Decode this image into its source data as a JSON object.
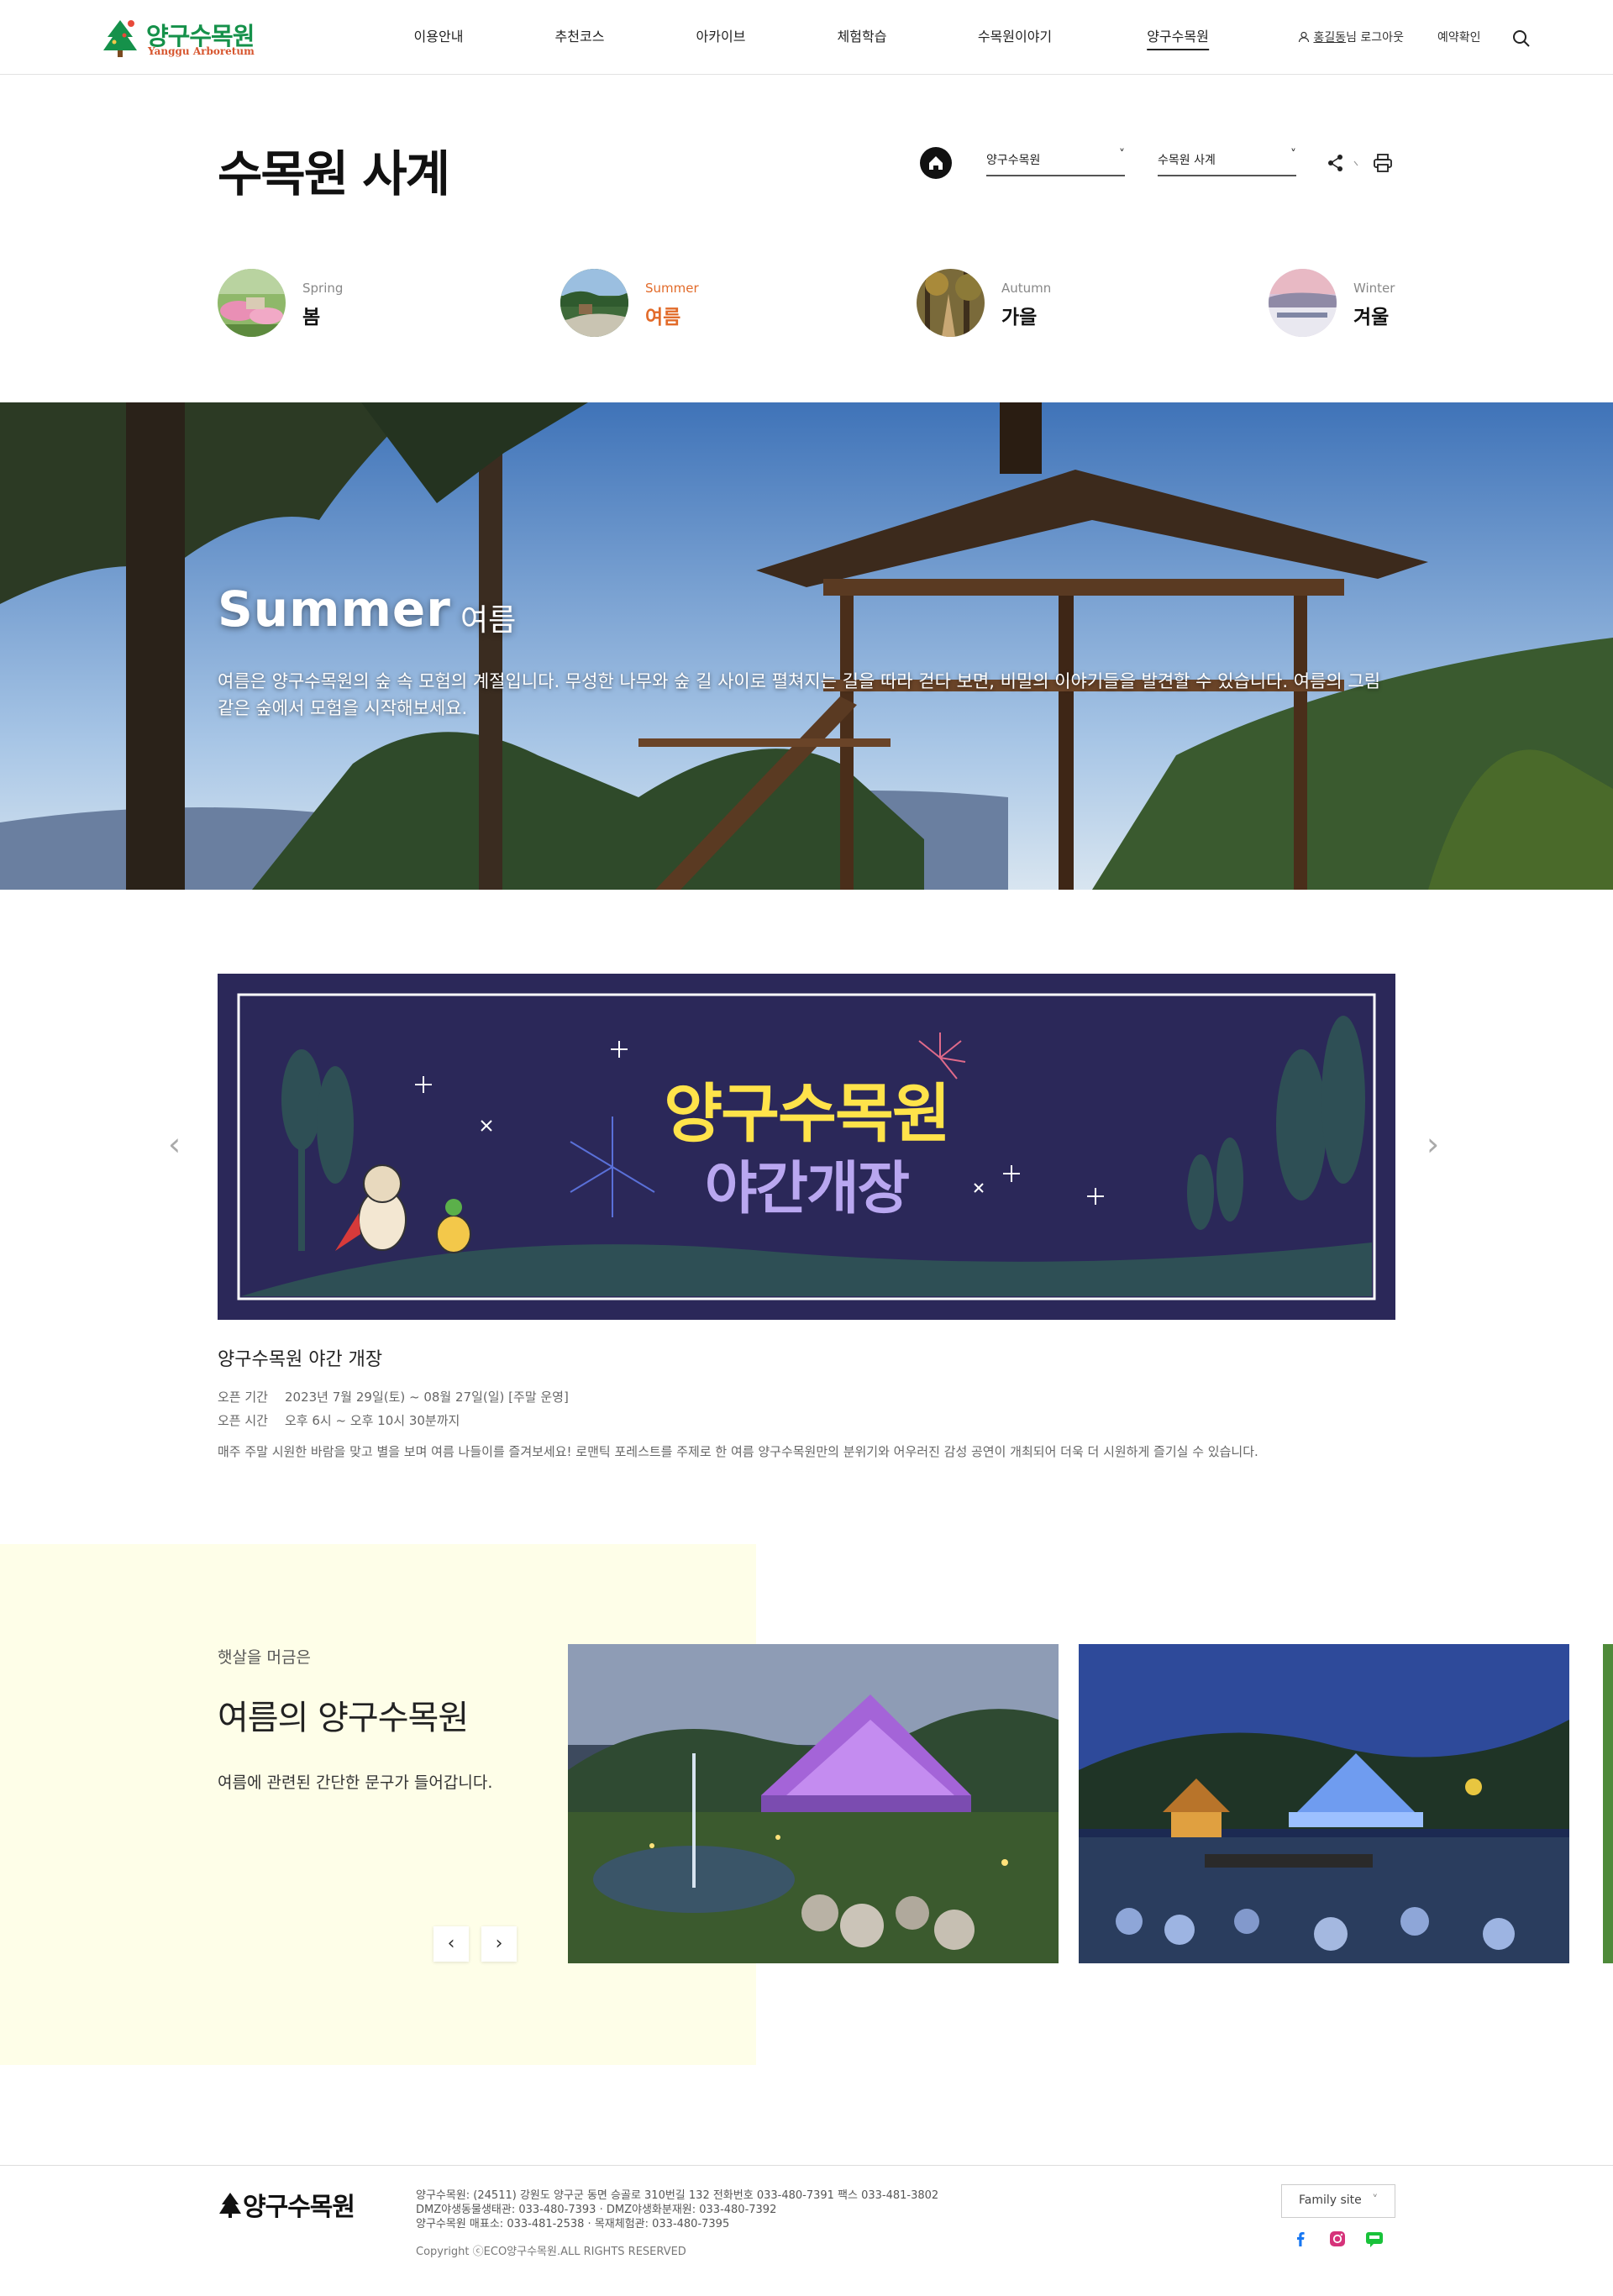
{
  "header": {
    "logo_ko": "양구수목원",
    "logo_en": "Yanggu Arboretum",
    "nav": [
      "이용안내",
      "추천코스",
      "아카이브",
      "체험학습",
      "수목원이야기",
      "양구수목원"
    ],
    "active_nav": "양구수목원",
    "user_name": "홍길동",
    "user_suffix": "님 로그아웃",
    "reservation": "예약확인"
  },
  "page": {
    "title": "수목원 사계",
    "select1": "양구수목원",
    "select2": "수목원 사계"
  },
  "seasons": [
    {
      "en": "Spring",
      "ko": "봄"
    },
    {
      "en": "Summer",
      "ko": "여름"
    },
    {
      "en": "Autumn",
      "ko": "가을"
    },
    {
      "en": "Winter",
      "ko": "겨울"
    }
  ],
  "active_season": "Summer",
  "hero": {
    "title": "Summer",
    "subtitle": "여름",
    "description": "여름은 양구수목원의 숲 속 모험의 계절입니다. 무성한 나무와 숲 길 사이로 펼쳐지는 길을 따라 걷다 보면, 비밀의 이야기들을 발견할 수 있습니다. 여름의 그림 같은 숲에서 모험을 시작해보세요."
  },
  "event": {
    "banner_line1": "양구수목원",
    "banner_line2": "야간개장",
    "title": "양구수목원 야간 개장",
    "period_label": "오픈 기간",
    "period": "2023년 7월 29일(토) ~ 08월 27일(일) [주말 운영]",
    "time_label": "오픈 시간",
    "time": "오후 6시 ~ 오후 10시 30분까지",
    "description": "매주 주말 시원한 바람을 맞고 별을 보며 여름 나들이를 즐겨보세요! 로맨틱 포레스트를 주제로 한 여름 양구수목원만의 분위기와 어우러진 감성 공연이 개최되어 더욱 더 시원하게 즐기실 수 있습니다."
  },
  "summer_section": {
    "pretitle": "햇살을 머금은",
    "heading": "여름의 양구수목원",
    "text": "여름에 관련된 간단한 문구가 들어갑니다."
  },
  "footer": {
    "logo": "양구수목원",
    "line1": "양구수목원: (24511) 강원도 양구군 동면 승골로 310번길 132 전화번호 033-480-7391 팩스 033-481-3802",
    "line2": "DMZ야생동물생태관: 033-480-7393 · DMZ야생화분재원: 033-480-7392",
    "line3": "양구수목원 매표소: 033-481-2538 · 목재체험관: 033-480-7395",
    "copyright": "Copyright ⓒECO양구수목원.ALL RIGHTS RESERVED",
    "family_site": "Family site"
  },
  "colors": {
    "brand_green": "#15914a",
    "accent_orange": "#e26b2a",
    "banner_navy": "#2b2859",
    "summer_bg": "#fefee8"
  }
}
